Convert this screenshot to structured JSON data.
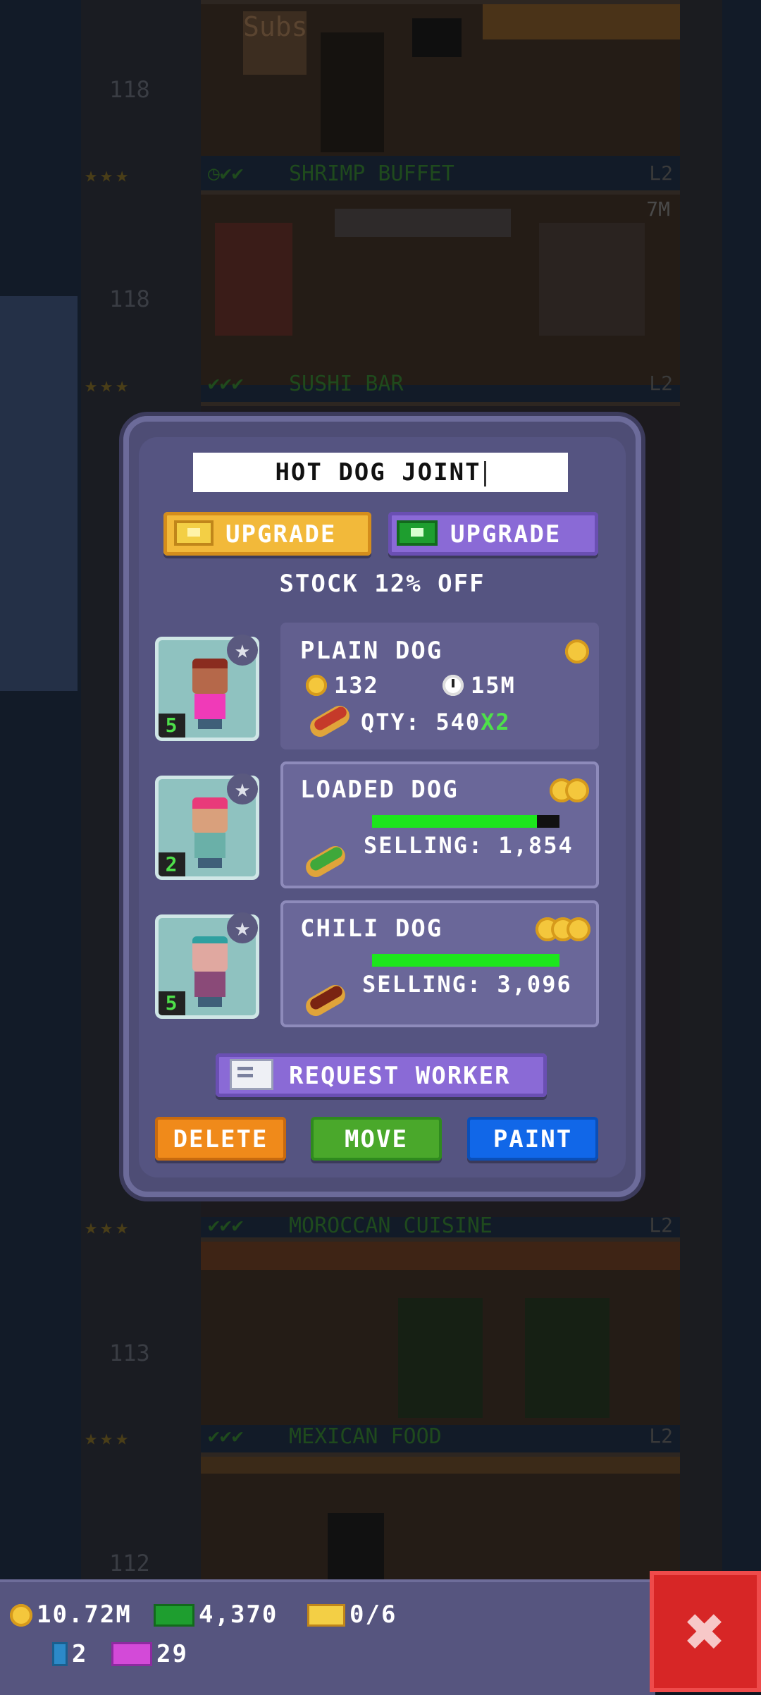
{
  "background": {
    "floors": [
      {
        "name": "SHRIMP BUFFET",
        "level": "L2",
        "stars": "★★★",
        "checks": "◷✔✔"
      },
      {
        "name": "SUSHI BAR",
        "level": "L2",
        "stars": "★★★",
        "checks": "✔✔✔"
      },
      {
        "name": "MOROCCAN CUISINE",
        "level": "L2",
        "stars": "★★★",
        "checks": "✔✔✔"
      },
      {
        "name": "MEXICAN FOOD",
        "level": "L2",
        "stars": "★★★",
        "checks": "✔✔✔"
      }
    ],
    "sign_text": "Subs",
    "price_tag": "7M",
    "floor_numbers": [
      "118",
      "118",
      "113",
      "112"
    ]
  },
  "dialog": {
    "store_name": "HOT DOG JOINT",
    "upgrade_gold_label": "UPGRADE",
    "upgrade_cash_label": "UPGRADE",
    "stock_text": "STOCK 12% OFF",
    "products": [
      {
        "name": "PLAIN DOG",
        "worker_level": "5",
        "tier_coins": 1,
        "cost": "132",
        "time": "15M",
        "qty_label": "QTY: 540",
        "multiplier": "X2",
        "state": "stocked"
      },
      {
        "name": "LOADED DOG",
        "worker_level": "2",
        "tier_coins": 2,
        "selling_label": "SELLING: 1,854",
        "progress": 0.88,
        "state": "selling"
      },
      {
        "name": "CHILI DOG",
        "worker_level": "5",
        "tier_coins": 3,
        "selling_label": "SELLING: 3,096",
        "progress": 1.0,
        "state": "selling"
      }
    ],
    "request_worker_label": "REQUEST WORKER",
    "delete_label": "DELETE",
    "move_label": "MOVE",
    "paint_label": "PAINT"
  },
  "status": {
    "coins": "10.72M",
    "bux": "4,370",
    "tickets": "0/6",
    "books": "2",
    "vip": "29"
  },
  "close_symbol": "✖",
  "star_symbol": "★",
  "icons": {
    "gold_upgrade": "golden-ticket-icon",
    "cash_upgrade": "tower-bux-icon",
    "request": "mail-icon",
    "close": "close-icon"
  }
}
